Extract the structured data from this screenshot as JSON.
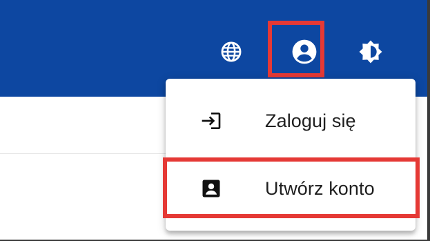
{
  "colors": {
    "app_bar": "#0d47a1",
    "icon_on_bar": "#ffffff",
    "highlight": "#e53935",
    "menu_text": "#1f1f1f"
  },
  "toolbar": {
    "language_icon": "globe-icon",
    "account_icon": "account-circle-icon",
    "theme_icon": "brightness-icon"
  },
  "account_menu": {
    "items": [
      {
        "label": "Zaloguj się",
        "icon": "login-icon"
      },
      {
        "label": "Utwórz konto",
        "icon": "account-box-icon"
      }
    ]
  }
}
